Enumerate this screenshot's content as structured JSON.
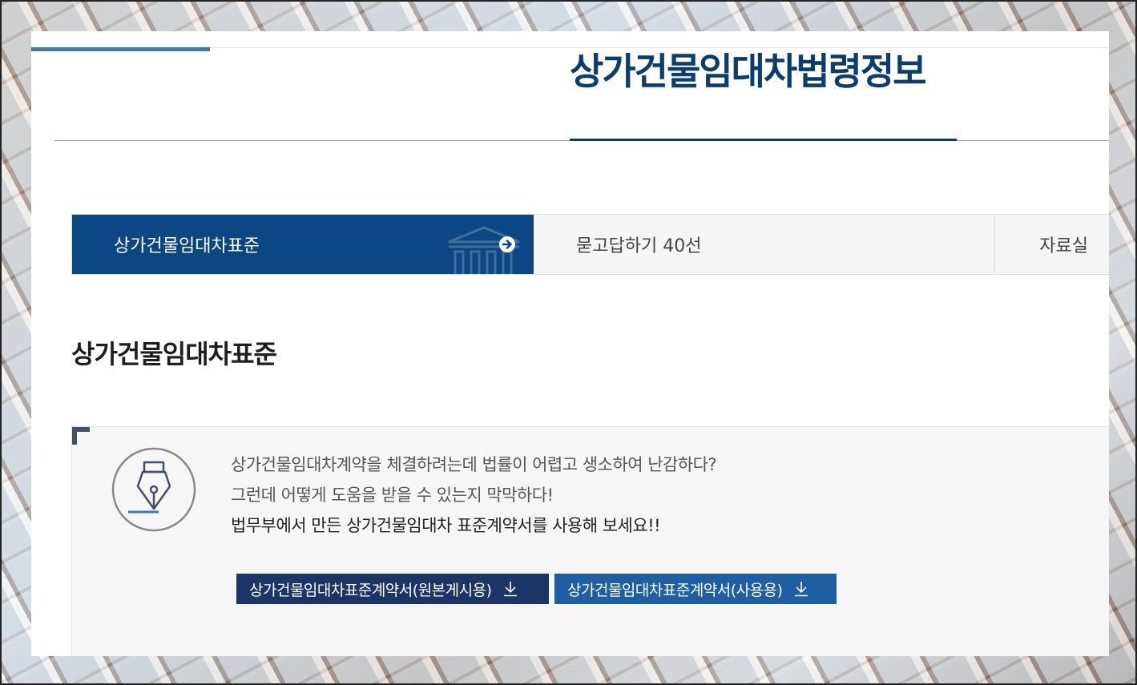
{
  "header": {
    "title": "상가건물임대차법령정보"
  },
  "tabs": [
    {
      "label": "상가건물임대차표준",
      "active": true
    },
    {
      "label": "묻고답하기 40선",
      "active": false
    },
    {
      "label": "자료실",
      "active": false
    }
  ],
  "section": {
    "title": "상가건물임대차표준"
  },
  "info": {
    "line1": "상가건물임대차계약을 체결하려는데 법률이 어렵고 생소하여 난감하다?",
    "line2": "그런데 어떻게 도움을 받을 수 있는지 막막하다!",
    "line3": "법무부에서 만든 상가건물임대차 표준계약서를 사용해 보세요!!"
  },
  "buttons": {
    "original": "상가건물임대차표준계약서(원본게시용)",
    "use": "상가건물임대차표준계약서(사용용)"
  },
  "colors": {
    "navy": "#0b3d70",
    "tab_active": "#0b4782",
    "btn_dark": "#1c3567",
    "btn_blue": "#1d5fa2"
  },
  "icons": [
    "building-icon",
    "arrow-right-circle-icon",
    "fountain-pen-icon",
    "download-icon"
  ]
}
